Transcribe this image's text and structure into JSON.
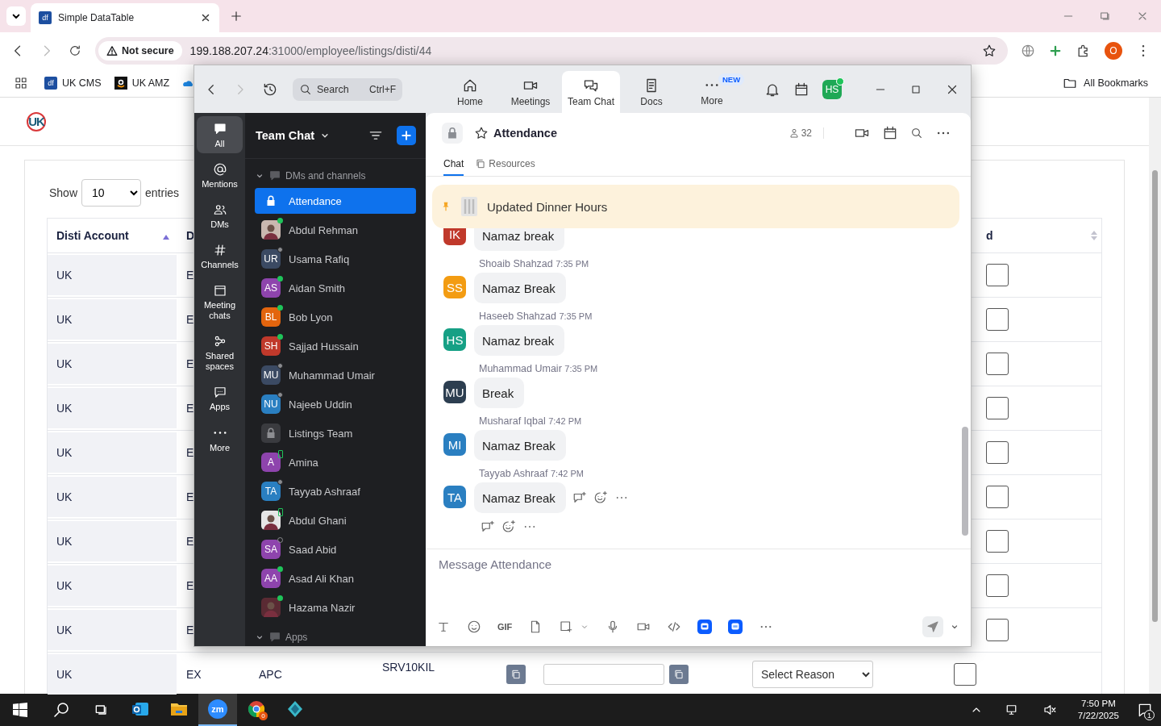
{
  "browser": {
    "tabs": [
      {
        "favicon": "df",
        "title": "Simple DataTable",
        "selected": true
      }
    ],
    "security_label": "Not secure",
    "url_host": "199.188.207.24",
    "url_path": ":31000/employee/listings/disti/44",
    "profile_initial": "O",
    "bookmarks": [
      {
        "kind": "df",
        "favicon": "df",
        "label": "UK CMS"
      },
      {
        "kind": "amazon",
        "label": "UK AMZ"
      },
      {
        "kind": "cloud"
      }
    ],
    "all_bookmarks": "All Bookmarks"
  },
  "page": {
    "logo": "UK",
    "show_label": "Show",
    "page_size": "10",
    "entries_label": "entries",
    "table": {
      "columns": [
        {
          "label": "Disti Account",
          "sorted": true
        },
        {
          "label": "D"
        },
        {
          "label": "d",
          "sorted": false
        }
      ],
      "rows": [
        {
          "disti_account": "UK",
          "column_2": "E",
          "checked": false
        },
        {
          "disti_account": "UK",
          "column_2": "E",
          "checked": false
        },
        {
          "disti_account": "UK",
          "column_2": "E",
          "checked": false
        },
        {
          "disti_account": "UK",
          "column_2": "E",
          "checked": false
        },
        {
          "disti_account": "UK",
          "column_2": "E",
          "checked": false
        },
        {
          "disti_account": "UK",
          "column_2": "E",
          "checked": false
        },
        {
          "disti_account": "UK",
          "column_2": "E",
          "checked": false
        },
        {
          "disti_account": "UK",
          "column_2": "E",
          "checked": false
        },
        {
          "disti_account": "UK",
          "column_2": "E",
          "checked": false
        },
        {
          "disti_account": "UK",
          "column_2": "EX",
          "column_3": "APC",
          "column_4": "SRV10KIL",
          "reason": "Select Reason",
          "checked": false
        }
      ]
    }
  },
  "zoom": {
    "search": {
      "placeholder": "Search",
      "shortcut": "Ctrl+F"
    },
    "nav_tabs": [
      {
        "kind": "home",
        "label": "Home",
        "selected": false
      },
      {
        "kind": "meetings",
        "label": "Meetings",
        "selected": false
      },
      {
        "kind": "chat",
        "label": "Team Chat",
        "selected": true
      },
      {
        "kind": "docs",
        "label": "Docs",
        "selected": false
      },
      {
        "kind": "more",
        "label": "More",
        "badge": "NEW",
        "selected": false
      }
    ],
    "user_initials": "HS",
    "user_online": true,
    "rail": [
      {
        "kind": "all",
        "label": "All",
        "selected": true
      },
      {
        "kind": "mentions",
        "label": "Mentions",
        "selected": false
      },
      {
        "kind": "dms",
        "label": "DMs",
        "selected": false
      },
      {
        "kind": "channels",
        "label": "Channels",
        "selected": false
      },
      {
        "kind": "meeting",
        "label": "Meeting chats",
        "selected": false
      },
      {
        "kind": "shared",
        "label": "Shared spaces",
        "selected": false
      },
      {
        "kind": "apps",
        "label": "Apps",
        "selected": false
      },
      {
        "kind": "more",
        "label": "More",
        "selected": false
      }
    ],
    "list_title": "Team Chat",
    "sections": [
      {
        "label": "DMs and channels",
        "expanded": true,
        "chats": [
          {
            "name": "Attendance",
            "avatar": {
              "kind": "lock"
            },
            "selected": true
          },
          {
            "name": "Abdul Rehman",
            "avatar": {
              "kind": "photo",
              "color": "#c9b8b0"
            },
            "status": {
              "kind": "online"
            },
            "selected": false
          },
          {
            "name": "Usama Rafiq",
            "avatar": {
              "kind": "initials",
              "initials": "UR",
              "color": "#3b4a63"
            },
            "status": {
              "kind": "away"
            },
            "selected": false
          },
          {
            "name": "Aidan Smith",
            "avatar": {
              "kind": "initials",
              "initials": "AS",
              "color": "#8e44ad"
            },
            "status": {
              "kind": "online"
            },
            "selected": false
          },
          {
            "name": "Bob Lyon",
            "avatar": {
              "kind": "initials",
              "initials": "BL",
              "color": "#e3650e"
            },
            "status": {
              "kind": "online"
            },
            "selected": false
          },
          {
            "name": "Sajjad Hussain",
            "avatar": {
              "kind": "initials",
              "initials": "SH",
              "color": "#c0392b"
            },
            "status": {
              "kind": "online"
            },
            "selected": false
          },
          {
            "name": "Muhammad Umair",
            "avatar": {
              "kind": "initials",
              "initials": "MU",
              "color": "#3b4a63"
            },
            "status": {
              "kind": "away"
            },
            "selected": false
          },
          {
            "name": "Najeeb Uddin",
            "avatar": {
              "kind": "initials",
              "initials": "NU",
              "color": "#2a7fc1"
            },
            "status": {
              "kind": "away"
            },
            "selected": false
          },
          {
            "name": "Listings Team",
            "avatar": {
              "kind": "lock"
            },
            "selected": false
          },
          {
            "name": "Amina",
            "avatar": {
              "kind": "initials",
              "initials": "A",
              "color": "#8e44ad"
            },
            "status": {
              "kind": "mobile"
            },
            "selected": false
          },
          {
            "name": "Tayyab Ashraaf",
            "avatar": {
              "kind": "initials",
              "initials": "TA",
              "color": "#2a7fc1"
            },
            "status": {
              "kind": "away"
            },
            "selected": false
          },
          {
            "name": "Abdul Ghani",
            "avatar": {
              "kind": "photo",
              "color": "#e6e6e6"
            },
            "status": {
              "kind": "mobile"
            },
            "selected": false
          },
          {
            "name": "Saad Abid",
            "avatar": {
              "kind": "initials",
              "initials": "SA",
              "color": "#8e44ad"
            },
            "status": {
              "kind": "offline"
            },
            "selected": false
          },
          {
            "name": "Asad Ali Khan",
            "avatar": {
              "kind": "initials",
              "initials": "AA",
              "color": "#8e44ad"
            },
            "status": {
              "kind": "online"
            },
            "selected": false
          },
          {
            "name": "Hazama Nazir",
            "avatar": {
              "kind": "photo",
              "color": "#5a2a33"
            },
            "status": {
              "kind": "online"
            },
            "selected": false
          }
        ]
      },
      {
        "label": "Apps",
        "expanded": true
      }
    ],
    "channel": {
      "name": "Attendance",
      "member_count": "32",
      "tabs": [
        {
          "kind": "chat",
          "label": "Chat",
          "selected": true
        },
        {
          "kind": "resources",
          "label": "Resources",
          "selected": false
        }
      ]
    },
    "pinned": "Updated Dinner Hours",
    "messages": [
      {
        "initials": "IK",
        "color": "#c0392b",
        "text": "Namaz break"
      },
      {
        "sender": "Shoaib Shahzad",
        "time": "7:35 PM",
        "initials": "SS",
        "color": "#f39c12",
        "text": "Namaz Break"
      },
      {
        "sender": "Haseeb Shahzad",
        "time": "7:35 PM",
        "initials": "HS",
        "color": "#16a085",
        "text": "Namaz break"
      },
      {
        "sender": "Muhammad Umair",
        "time": "7:35 PM",
        "initials": "MU",
        "color": "#2c3e50",
        "text": "Break"
      },
      {
        "sender": "Musharaf Iqbal",
        "time": "7:42 PM",
        "initials": "MI",
        "color": "#2a7fc1",
        "text": "Namaz Break"
      },
      {
        "sender": "Tayyab Ashraaf",
        "time": "7:42 PM",
        "initials": "TA",
        "color": "#2a7fc1",
        "text": "Namaz Break",
        "hovered": true
      }
    ],
    "composer_placeholder": "Message Attendance",
    "composer_tools": [
      {
        "kind": "format"
      },
      {
        "kind": "emoji"
      },
      {
        "kind": "gif",
        "label": "GIF"
      },
      {
        "kind": "file"
      },
      {
        "kind": "screenshot"
      },
      {
        "kind": "caret"
      },
      {
        "kind": "mic"
      },
      {
        "kind": "video"
      },
      {
        "kind": "code"
      },
      {
        "kind": "app"
      },
      {
        "kind": "app2"
      },
      {
        "kind": "more"
      }
    ]
  },
  "taskbar": {
    "apps": [
      {
        "kind": "mail",
        "active": false
      },
      {
        "kind": "folder",
        "active": false
      },
      {
        "kind": "zoom",
        "label": "zm",
        "active": true
      },
      {
        "kind": "browser",
        "badge": "0",
        "active": false
      },
      {
        "kind": "diamond",
        "active": false
      }
    ],
    "time": "7:50 PM",
    "date": "7/22/2025",
    "notifications": "1"
  }
}
